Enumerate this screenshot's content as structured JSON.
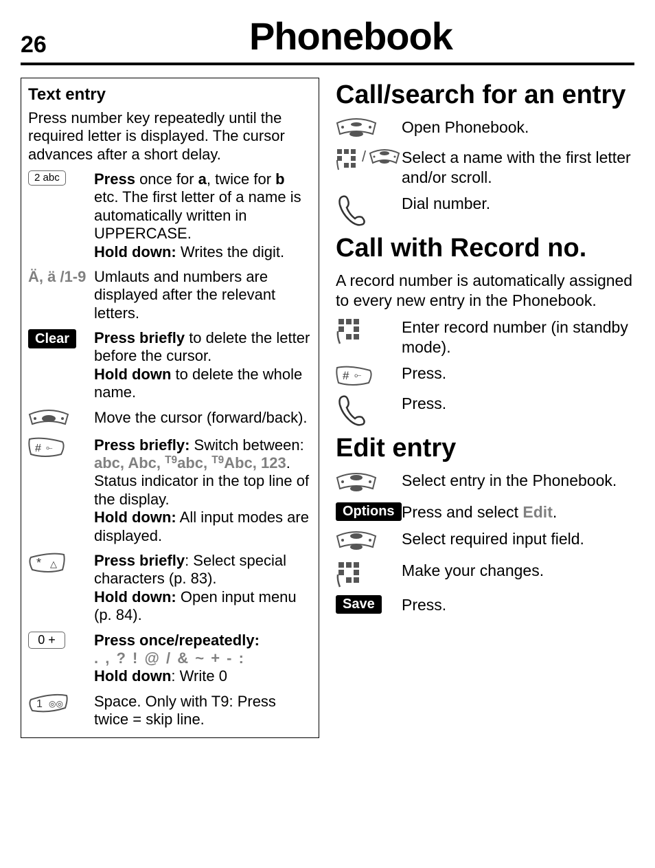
{
  "header": {
    "page": "26",
    "title": "Phonebook"
  },
  "left": {
    "title": "Text entry",
    "intro": "Press number key repeatedly until the required letter is displayed. The cursor advances after a short delay.",
    "k2": {
      "label": "2 abc",
      "p1a": "Press",
      "p1b": " once for ",
      "p1c": "a",
      "p1d": ", twice for ",
      "p1e": "b",
      "p1f": " etc. The first letter of a name is automatically written in UPPERCASE.",
      "p2a": "Hold down:",
      "p2b": " Writes the digit."
    },
    "umlaut": {
      "label": "Ä, ä /1-9",
      "text": "Umlauts and numbers are displayed after the relevant letters."
    },
    "clear": {
      "label": "Clear",
      "p1a": "Press briefly",
      "p1b": " to delete the letter before the cursor.",
      "p2a": "Hold down",
      "p2b": " to delete the whole name."
    },
    "rocker": {
      "text": "Move the cursor (forward/back)."
    },
    "hash": {
      "label": "#",
      "p1a": "Press briefly:",
      "p1b": " Switch between: ",
      "modes1a": "abc, Abc, ",
      "modes1sup": "T9",
      "modes1b": "abc, ",
      "modes2sup": "T9",
      "modes2a": "Abc, 123",
      "p1c": ". Status indicator in the top line of the display.",
      "p2a": "Hold down:",
      "p2b": " All input modes are displayed."
    },
    "star": {
      "label": "*",
      "p1a": "Press briefly",
      "p1b": ": Select special characters (p. 83).",
      "p2a": "Hold down:",
      "p2b": " Open input menu (p. 84)."
    },
    "zero": {
      "label": "0 +",
      "p1a": "Press once/repeatedly:",
      "seq": ". , ? ! @ / & ~ + - :",
      "p2a": "Hold down",
      "p2b": ": Write 0"
    },
    "one": {
      "label": "1",
      "text": "Space. Only with T9: Press twice = skip line."
    }
  },
  "right": {
    "s1": {
      "heading": "Call/search for an entry",
      "r1": "Open Phonebook.",
      "r2": "Select a name with the first letter and/or scroll.",
      "r3": "Dial number."
    },
    "s2": {
      "heading": "Call with Record no.",
      "intro": "A record number is automatically assigned to every new entry in the Phonebook.",
      "r1": "Enter record number (in standby mode).",
      "r2": "Press.",
      "r3": "Press."
    },
    "s3": {
      "heading": "Edit entry",
      "r1": "Select entry in the Phonebook.",
      "optLabel": "Options",
      "r2a": "Press and select ",
      "r2b": "Edit",
      "r2c": ".",
      "r3": "Select required input field.",
      "r4": "Make your changes.",
      "saveLabel": "Save",
      "r5": "Press."
    }
  }
}
